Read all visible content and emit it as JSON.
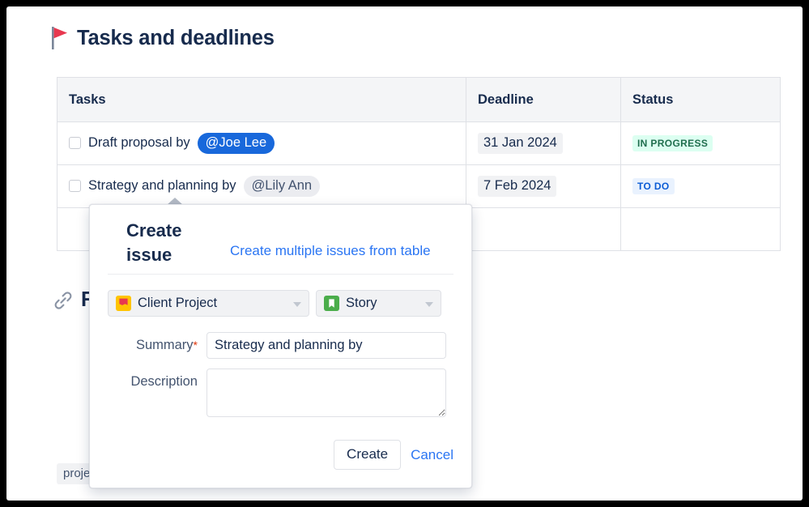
{
  "page": {
    "title": "Tasks and deadlines",
    "flag_icon": "red-flag-icon"
  },
  "table": {
    "columns": [
      "Tasks",
      "Deadline",
      "Status"
    ],
    "rows": [
      {
        "task_text": "Draft proposal by",
        "mention": "@Joe Lee",
        "mention_style": "blue",
        "deadline": "31 Jan 2024",
        "status": "IN PROGRESS",
        "status_style": "green"
      },
      {
        "task_text": "Strategy and planning by",
        "mention": "@Lily Ann",
        "mention_style": "grey",
        "deadline": "7 Feb 2024",
        "status": "TO DO",
        "status_style": "blue"
      },
      {
        "task_text": "",
        "mention": "",
        "mention_style": "",
        "deadline": "",
        "status": "",
        "status_style": ""
      }
    ]
  },
  "background": {
    "related_heading": "R",
    "related_icon": "link-icon",
    "bottom_chip": "proje"
  },
  "popup": {
    "title": "Create issue",
    "multiple_link": "Create multiple issues from table",
    "project_select": {
      "value": "Client Project",
      "icon": "project-avatar-icon"
    },
    "type_select": {
      "value": "Story",
      "icon": "story-bookmark-icon"
    },
    "summary": {
      "label": "Summary",
      "required_marker": "*",
      "value": "Strategy and planning by",
      "placeholder": ""
    },
    "description": {
      "label": "Description",
      "value": "",
      "placeholder": ""
    },
    "create_button": "Create",
    "cancel_button": "Cancel"
  },
  "colors": {
    "accent_blue": "#2a75f3",
    "mention_blue": "#1868db",
    "status_green_text": "#206e4e",
    "status_green_bg": "#dcfff1",
    "status_blue_text": "#0b5cd5",
    "status_blue_bg": "#e9f2fe",
    "text_dark": "#172b4d",
    "required_red": "#de350b"
  }
}
